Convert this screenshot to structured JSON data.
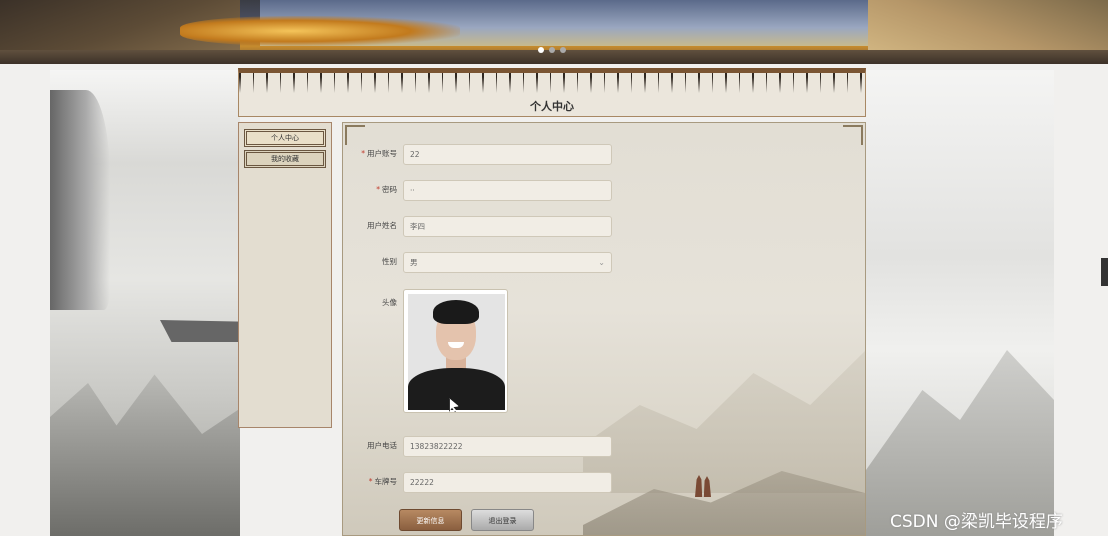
{
  "banner": {
    "dots_count": 3,
    "active_dot": 1
  },
  "header": {
    "title": "个人中心"
  },
  "sidebar": {
    "items": [
      {
        "label": "个人中心",
        "active": true
      },
      {
        "label": "我的收藏",
        "active": false
      }
    ]
  },
  "form": {
    "account": {
      "label": "用户账号",
      "required": true,
      "value": "22"
    },
    "password": {
      "label": "密码",
      "required": true,
      "value": "··"
    },
    "name": {
      "label": "用户姓名",
      "required": false,
      "value": "李四"
    },
    "gender": {
      "label": "性别",
      "required": false,
      "value": "男"
    },
    "avatar": {
      "label": "头像"
    },
    "phone": {
      "label": "用户电话",
      "required": false,
      "value": "13823822222"
    },
    "plate": {
      "label": "车牌号",
      "required": true,
      "value": "22222"
    }
  },
  "buttons": {
    "update": "更新信息",
    "logout": "退出登录"
  },
  "watermark": "CSDN @梁凯毕设程序",
  "colors": {
    "primary_button": "#9b6c48",
    "required_mark": "#c0392b",
    "frame_border": "#a88864"
  }
}
